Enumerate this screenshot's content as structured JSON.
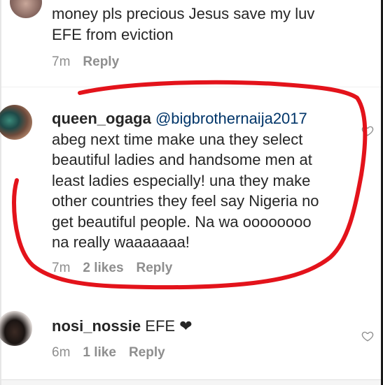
{
  "comments": [
    {
      "username": "",
      "text_line1": "money pls precious Jesus save my luv",
      "text_line2": "EFE from eviction",
      "time": "7m",
      "likes": "",
      "reply": "Reply"
    },
    {
      "username": "queen_ogaga",
      "mention": "@bigbrothernaija2017",
      "lines": [
        "abeg next time make una they select",
        "beautiful ladies and handsome men at",
        "least ladies especially! una they make",
        "other countries they feel say Nigeria no",
        "get beautiful people. Na wa oooooooo",
        "na really waaaaaaa!"
      ],
      "time": "7m",
      "likes": "2 likes",
      "reply": "Reply"
    },
    {
      "username": "nosi_nossie",
      "text": "EFE",
      "heart": "❤",
      "time": "6m",
      "likes": "1 like",
      "reply": "Reply"
    }
  ],
  "colors": {
    "annotation": "#e3131b",
    "meta": "#8e8e8e",
    "text": "#262626"
  },
  "icons": [
    "avatar-top",
    "avatar-queen",
    "avatar-nosi",
    "heart-outline-icon"
  ]
}
